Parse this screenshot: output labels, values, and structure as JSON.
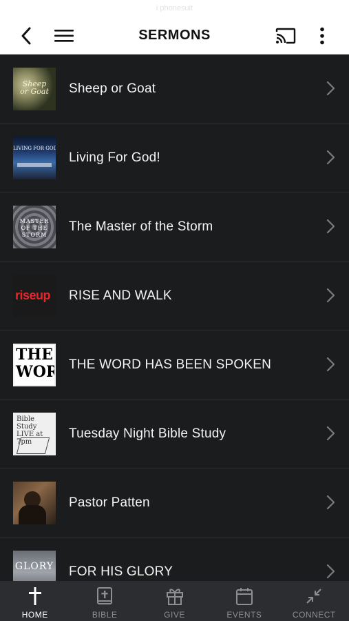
{
  "status_hint": "i phonesuit",
  "header": {
    "title": "SERMONS",
    "back_icon": "back-chevron-icon",
    "menu_icon": "hamburger-menu-icon",
    "cast_icon": "cast-icon",
    "more_icon": "more-vertical-icon"
  },
  "sermons": [
    {
      "title": "Sheep or Goat",
      "thumb_text": "Sheep or Goat"
    },
    {
      "title": "Living For God!",
      "thumb_text": "LIVING FOR GOD"
    },
    {
      "title": "The Master of the Storm",
      "thumb_text": "MASTER OF THE STORM"
    },
    {
      "title": "RISE AND WALK",
      "thumb_text": "riseup"
    },
    {
      "title": "THE WORD HAS BEEN SPOKEN",
      "thumb_text": "THE WORD"
    },
    {
      "title": "Tuesday Night Bible Study",
      "thumb_text": "Bible Study LIVE at 7pm"
    },
    {
      "title": "Pastor Patten",
      "thumb_text": ""
    },
    {
      "title": "FOR HIS GLORY",
      "thumb_text": "GLORY"
    }
  ],
  "tabs": [
    {
      "label": "HOME",
      "icon": "cross-icon",
      "active": true
    },
    {
      "label": "BIBLE",
      "icon": "bible-icon",
      "active": false
    },
    {
      "label": "GIVE",
      "icon": "gift-icon",
      "active": false
    },
    {
      "label": "EVENTS",
      "icon": "calendar-icon",
      "active": false
    },
    {
      "label": "CONNECT",
      "icon": "connect-arrows-icon",
      "active": false
    }
  ],
  "colors": {
    "background": "#1b1c1e",
    "header_bg": "#ffffff",
    "tabbar_bg": "#2c2d30",
    "tab_active": "#ffffff",
    "tab_inactive": "#8e8f93"
  }
}
